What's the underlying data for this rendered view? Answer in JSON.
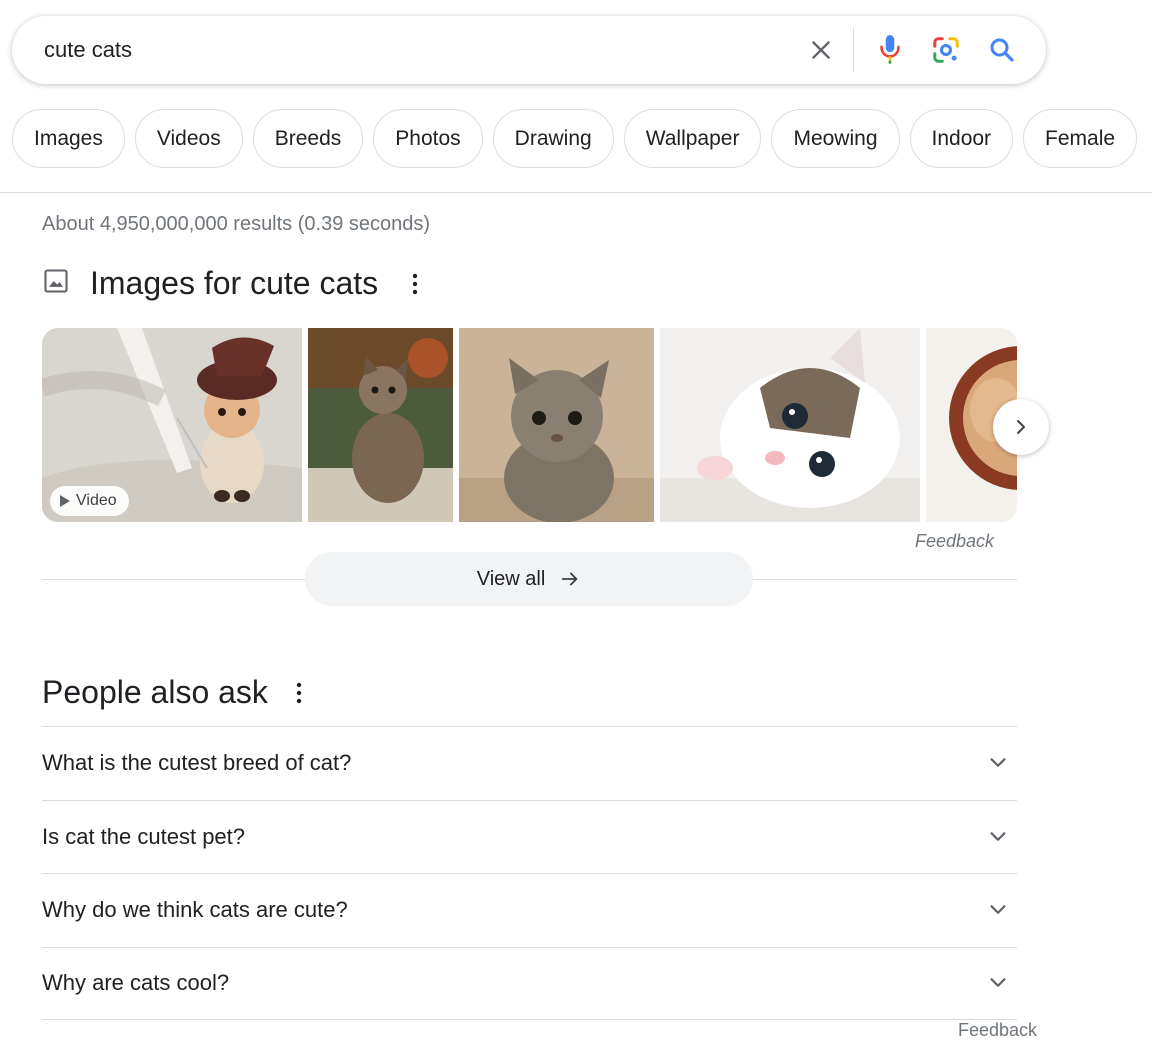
{
  "search": {
    "query": "cute cats",
    "icons": [
      "close-icon",
      "microphone-icon",
      "google-lens-icon",
      "search-icon"
    ]
  },
  "chips": [
    "Images",
    "Videos",
    "Breeds",
    "Photos",
    "Drawing",
    "Wallpaper",
    "Meowing",
    "Indoor",
    "Female"
  ],
  "results_count": "About 4,950,000,000 results (0.39 seconds)",
  "images_section": {
    "title": "Images for cute cats",
    "video_badge": "Video",
    "feedback": "Feedback",
    "view_all": "View all"
  },
  "people_also_ask": {
    "title": "People also ask",
    "questions": [
      "What is the cutest breed of cat?",
      "Is cat the cutest pet?",
      "Why do we think cats are cute?",
      "Why are cats cool?"
    ],
    "feedback": "Feedback"
  },
  "colors": {
    "google_blue": "#4285F4",
    "google_red": "#EA4335",
    "google_yellow": "#FBBC05",
    "google_green": "#34A853",
    "search_icon_blue": "#4285F4"
  }
}
